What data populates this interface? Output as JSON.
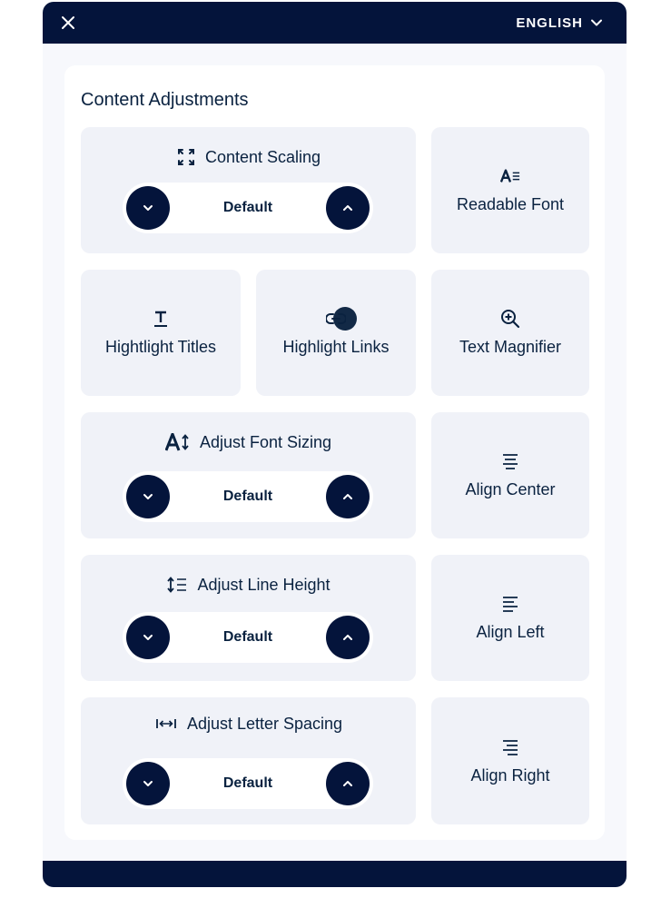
{
  "header": {
    "close_icon": "close-icon",
    "language_label": "ENGLISH",
    "language_chevron_icon": "chevron-down-icon"
  },
  "section": {
    "title": "Content Adjustments"
  },
  "tiles": {
    "content_scaling": {
      "label": "Content Scaling",
      "icon": "expand-icon",
      "value": "Default"
    },
    "readable_font": {
      "label": "Readable Font",
      "icon": "readable-font-icon"
    },
    "highlight_titles": {
      "label": "Hightlight Titles",
      "icon": "underline-title-icon"
    },
    "highlight_links": {
      "label": "Highlight Links",
      "icon": "link-icon"
    },
    "text_magnifier": {
      "label": "Text Magnifier",
      "icon": "zoom-in-icon"
    },
    "font_sizing": {
      "label": "Adjust Font Sizing",
      "icon": "font-size-icon",
      "value": "Default"
    },
    "align_center": {
      "label": "Align Center",
      "icon": "align-center-icon"
    },
    "line_height": {
      "label": "Adjust Line Height",
      "icon": "line-height-icon",
      "value": "Default"
    },
    "align_left": {
      "label": "Align Left",
      "icon": "align-left-icon"
    },
    "letter_spacing": {
      "label": "Adjust Letter Spacing",
      "icon": "letter-spacing-icon",
      "value": "Default"
    },
    "align_right": {
      "label": "Align Right",
      "icon": "align-right-icon"
    }
  },
  "colors": {
    "brand_dark": "#04143b",
    "text": "#0a2240",
    "tile_bg": "#f0f2f8",
    "panel_bg": "#f7f8fc"
  }
}
